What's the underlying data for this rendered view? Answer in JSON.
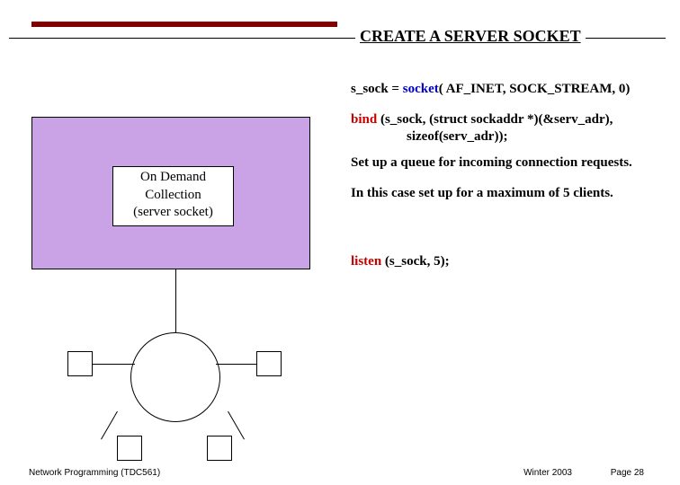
{
  "title": "CREATE A SERVER SOCKET",
  "code": {
    "line1_pre": "s_sock = ",
    "socket_kw": "socket",
    "line1_post": "( AF_INET, SOCK_STREAM, 0)",
    "bind_kw": "bind",
    "line2_post": " (s_sock, (struct sockaddr *)(&serv_adr),",
    "line2_indent": "sizeof(serv_adr));",
    "listen_kw": "listen",
    "line5_post": " (s_sock, 5);"
  },
  "explain": {
    "setup": "Set up a queue for incoming connection requests.",
    "case": "In this case set up for a maximum of 5 clients."
  },
  "diagram_box": {
    "l1": "On Demand",
    "l2": "Collection",
    "l3": "(server socket)"
  },
  "footer": {
    "left": "Network Programming (TDC561)",
    "mid": "Winter 2003",
    "right": "Page 28"
  }
}
